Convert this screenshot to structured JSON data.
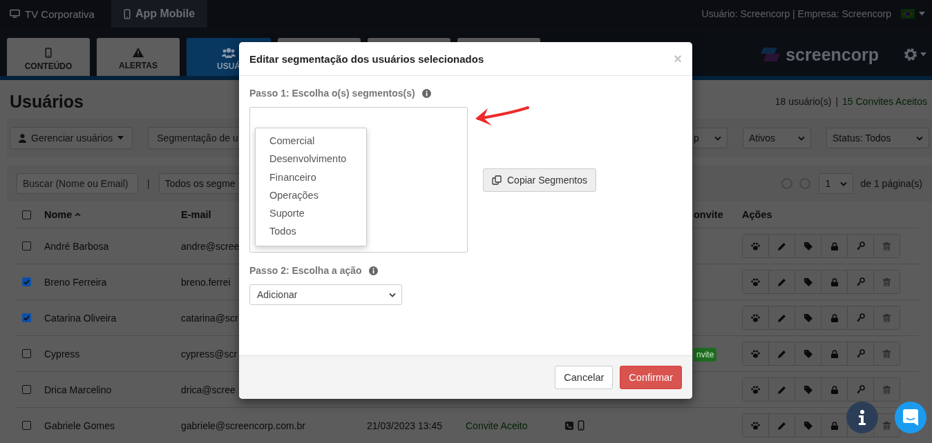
{
  "top_bar": {
    "apps": [
      {
        "label": "TV Corporativa",
        "selected": false
      },
      {
        "label": "App Mobile",
        "selected": true
      }
    ],
    "user_info": "Usuário: Screencorp | Empresa: Screencorp"
  },
  "nav_tabs": [
    {
      "label": "CONTEÚDO",
      "selected": false
    },
    {
      "label": "ALERTAS",
      "selected": false
    },
    {
      "label": "USUÁ",
      "selected": true
    },
    {
      "selected": false
    },
    {
      "selected": false
    },
    {
      "selected": false
    }
  ],
  "logo": "screencorp",
  "page": {
    "title": "Usuários",
    "user_count": "18 usuário(s)",
    "separator": "|",
    "accepted_count": "15 Convites Aceitos"
  },
  "toolbar": {
    "manage_button": "Gerenciar usuários",
    "segment_button": "Segmentação de u",
    "selects": [
      "p",
      "Ativos",
      "Status: Todos"
    ]
  },
  "filters": {
    "search": {
      "placeholder": "Buscar (Nome ou Email)"
    },
    "separator": "|",
    "segment_select": "Todos os segme",
    "page_select": "1",
    "page_total": "de 1 página(s)"
  },
  "table": {
    "all_selected": false,
    "columns": {
      "name": "Nome",
      "name_sorted": true,
      "email": "E-mail",
      "column_7": "onvite",
      "actions": "Ações"
    },
    "rows": [
      {
        "selected": false,
        "name": "André Barbosa",
        "email": "andre@scree"
      },
      {
        "selected": true,
        "name": "Breno Ferreira",
        "email": "breno.ferrei"
      },
      {
        "selected": true,
        "name": "Catarina Oliveira",
        "email": "catarina@scr"
      },
      {
        "selected": false,
        "name": "Cypress",
        "email": "cypress@scr",
        "badge": "nvite"
      },
      {
        "selected": false,
        "name": "Drica Marcelino",
        "email": "drica@scree"
      },
      {
        "selected": false,
        "name": "Gabriele Gomes",
        "email": "gabriele@screencorp.com.br",
        "date": "21/03/2023 13:45",
        "status": "Convite Aceito",
        "devices": true
      }
    ]
  },
  "modal": {
    "title": "Editar segmentação dos usuários selecionados",
    "close": "×",
    "step1": "Passo 1: Escolha o(s) segmentos(s)",
    "segments": [
      "Comercial",
      "Desenvolvimento",
      "Financeiro",
      "Operações",
      "Suporte",
      "Todos"
    ],
    "copy_button": "Copiar Segmentos",
    "step2": "Passo 2: Escolha a ação",
    "action": "Adicionar",
    "cancel": "Cancelar",
    "confirm": "Confirmar"
  }
}
